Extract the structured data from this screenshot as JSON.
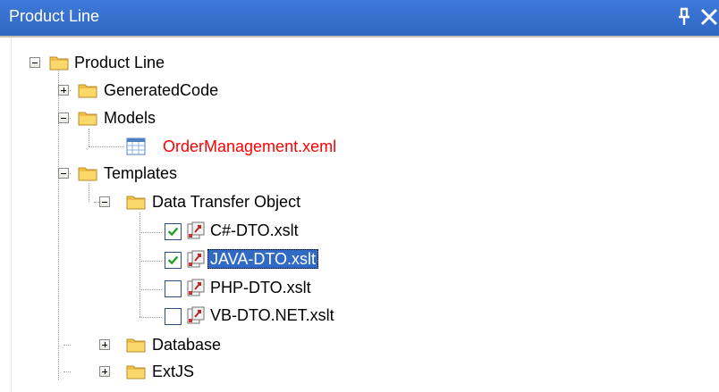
{
  "panel": {
    "title": "Product Line",
    "pin_icon": "pin-icon",
    "close_icon": "close-icon"
  },
  "tree": {
    "root": {
      "label": "Product Line",
      "expanded": true
    },
    "generated_code": {
      "label": "GeneratedCode",
      "expanded": false
    },
    "models": {
      "label": "Models",
      "expanded": true
    },
    "order_management": {
      "label": "OrderManagement.xeml",
      "color": "#ff0000",
      "icon": "table-icon"
    },
    "templates": {
      "label": "Templates",
      "expanded": true
    },
    "dto": {
      "label": "Data Transfer Object",
      "expanded": true
    },
    "csharp_dto": {
      "label": "C#-DTO.xslt",
      "checked": true
    },
    "java_dto": {
      "label": "JAVA-DTO.xslt",
      "checked": true,
      "selected": true
    },
    "php_dto": {
      "label": "PHP-DTO.xslt",
      "checked": false
    },
    "vb_dto": {
      "label": "VB-DTO.NET.xslt",
      "checked": false
    },
    "database": {
      "label": "Database",
      "expanded": false
    },
    "extjs": {
      "label": "ExtJS",
      "expanded": false
    }
  },
  "colors": {
    "title_bar": "#2f66c4",
    "selection": "#316ac5",
    "check_mark": "#21a121",
    "folder": "#f3c64a"
  }
}
